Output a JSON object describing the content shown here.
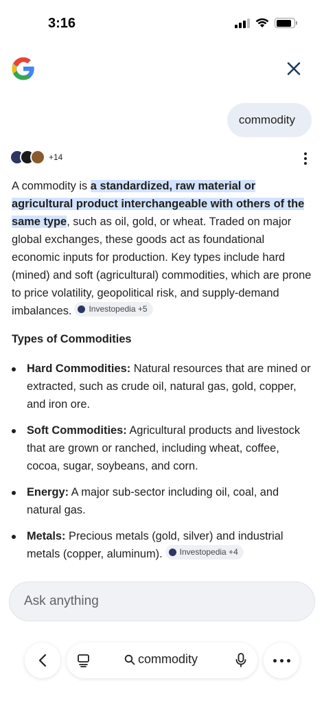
{
  "status_bar": {
    "time": "3:16"
  },
  "query": {
    "text": "commodity"
  },
  "sources": {
    "count_label": "+14"
  },
  "answer": {
    "intro_before": "A commodity is ",
    "highlight": "a standardized, raw material or agricultural product interchangeable with others of the same type",
    "intro_after": ", such as oil, gold, or wheat. Traded on major global exchanges, these goods act as foundational economic inputs for production. Key types include hard (mined) and soft (agricultural) commodities, which are prone to price volatility, geopolitical risk, and supply-demand imbalances.",
    "citation": "Investopedia +5"
  },
  "types_section": {
    "title": "Types of Commodities",
    "items": [
      {
        "term": "Hard Commodities:",
        "text": " Natural resources that are mined or extracted, such as crude oil, natural gas, gold, copper, and iron ore.",
        "citation": ""
      },
      {
        "term": "Soft Commodities:",
        "text": " Agricultural products and livestock that are grown or ranched, including wheat, coffee, cocoa, sugar, soybeans, and corn.",
        "citation": ""
      },
      {
        "term": "Energy:",
        "text": " A major sub-sector including oil, coal, and natural gas.",
        "citation": ""
      },
      {
        "term": "Metals:",
        "text": " Precious metals (gold, silver) and industrial metals (copper, aluminum).",
        "citation": "Investopedia +4"
      }
    ]
  },
  "ask_bar": {
    "placeholder": "Ask anything"
  },
  "bottom_nav": {
    "search_text": "commodity"
  },
  "colors": {
    "highlight": "#d3e3fd",
    "bubble": "#e9eef6",
    "chip": "#eef0f3"
  }
}
